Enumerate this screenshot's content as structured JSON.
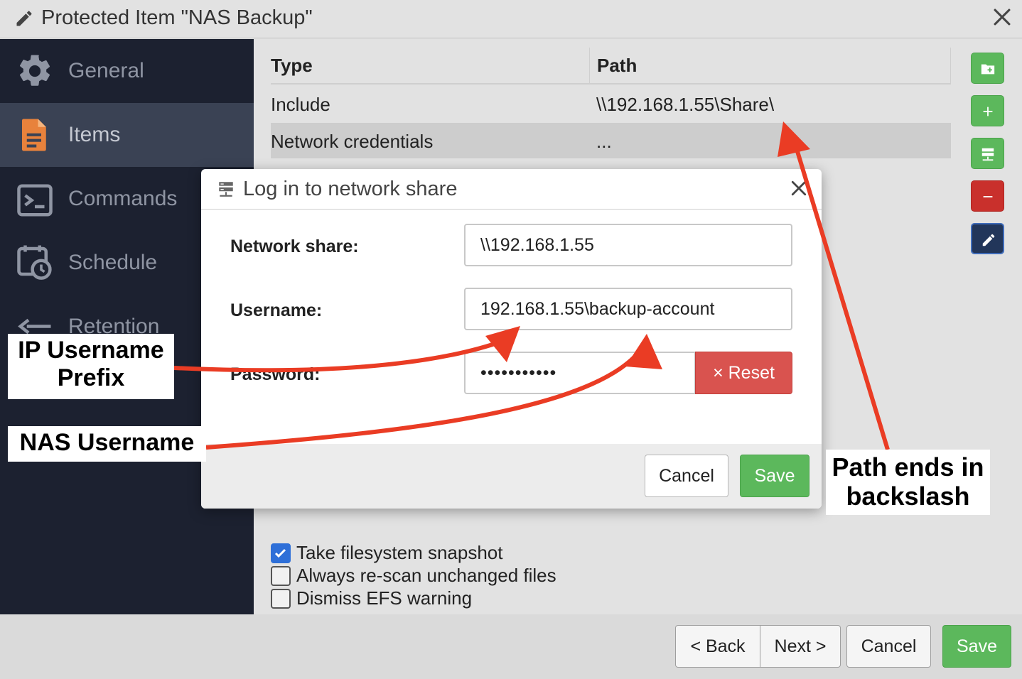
{
  "window": {
    "title": "Protected Item \"NAS Backup\""
  },
  "sidebar": {
    "items": [
      {
        "label": "General",
        "icon": "gear-icon"
      },
      {
        "label": "Items",
        "icon": "document-icon",
        "active": true
      },
      {
        "label": "Commands",
        "icon": "terminal-icon"
      },
      {
        "label": "Schedule",
        "icon": "calendar-clock-icon"
      },
      {
        "label": "Retention",
        "icon": "retention-icon"
      }
    ]
  },
  "table": {
    "headers": [
      "Type",
      "Path"
    ],
    "rows": [
      {
        "type": "Include",
        "path": "\\\\192.168.1.55\\Share\\"
      },
      {
        "type": "Network credentials",
        "path": "..."
      }
    ]
  },
  "toolbar": [
    "add-folder-icon",
    "plus-icon",
    "server-icon",
    "minus-icon",
    "pencil-icon"
  ],
  "options": [
    {
      "label": "Take filesystem snapshot",
      "checked": true
    },
    {
      "label": "Always re-scan unchanged files",
      "checked": false
    },
    {
      "label": "Dismiss EFS warning",
      "checked": false
    }
  ],
  "footer": {
    "back": "< Back",
    "next": "Next >",
    "cancel": "Cancel",
    "save": "Save"
  },
  "modal": {
    "title": "Log in to network share",
    "network_share_label": "Network share:",
    "network_share_value": "\\\\192.168.1.55",
    "username_label": "Username:",
    "username_value": "192.168.1.55\\backup-account",
    "password_label": "Password:",
    "password_value": "•••••••••••",
    "reset_label": "Reset",
    "reset_icon": "×",
    "cancel_label": "Cancel",
    "save_label": "Save"
  },
  "annotations": {
    "ip_prefix": "IP Username Prefix",
    "nas_username": "NAS Username",
    "path_note": "Path ends in backslash"
  },
  "colors": {
    "arrow": "#ea3c24",
    "save_green": "#5cb85c",
    "reset_red": "#d9534f",
    "sidebar_bg": "#1c2130",
    "active_item_bg": "#3a4254"
  }
}
